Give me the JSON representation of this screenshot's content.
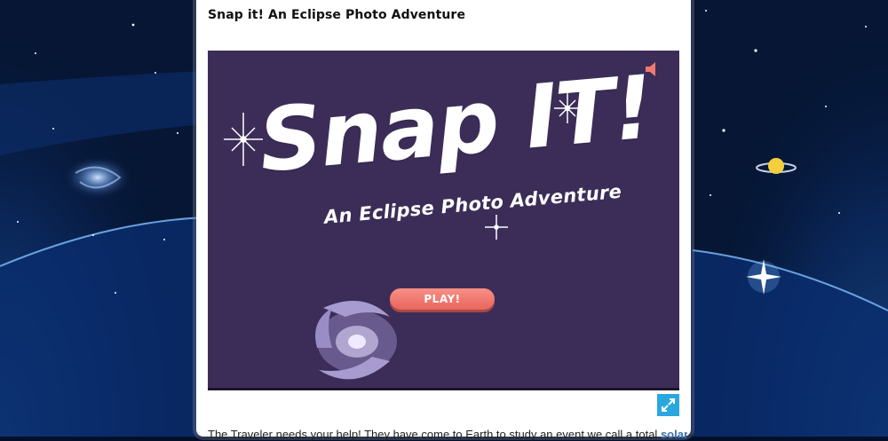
{
  "page": {
    "title": "Snap it! An Eclipse Photo Adventure"
  },
  "game": {
    "logo_title": "Snap IT!",
    "logo_subtitle": "An Eclipse Photo Adventure",
    "play_label": "PLAY!",
    "sound_icon": "speaker-icon",
    "fullscreen_icon": "expand-icon",
    "background_color": "#3c2d58",
    "play_button_color": "#f27870",
    "accent_color": "#2ba7df"
  },
  "intro": {
    "text": "The Traveler needs your help! They have come to Earth to study an event we call a total ",
    "link_text": "solar"
  }
}
